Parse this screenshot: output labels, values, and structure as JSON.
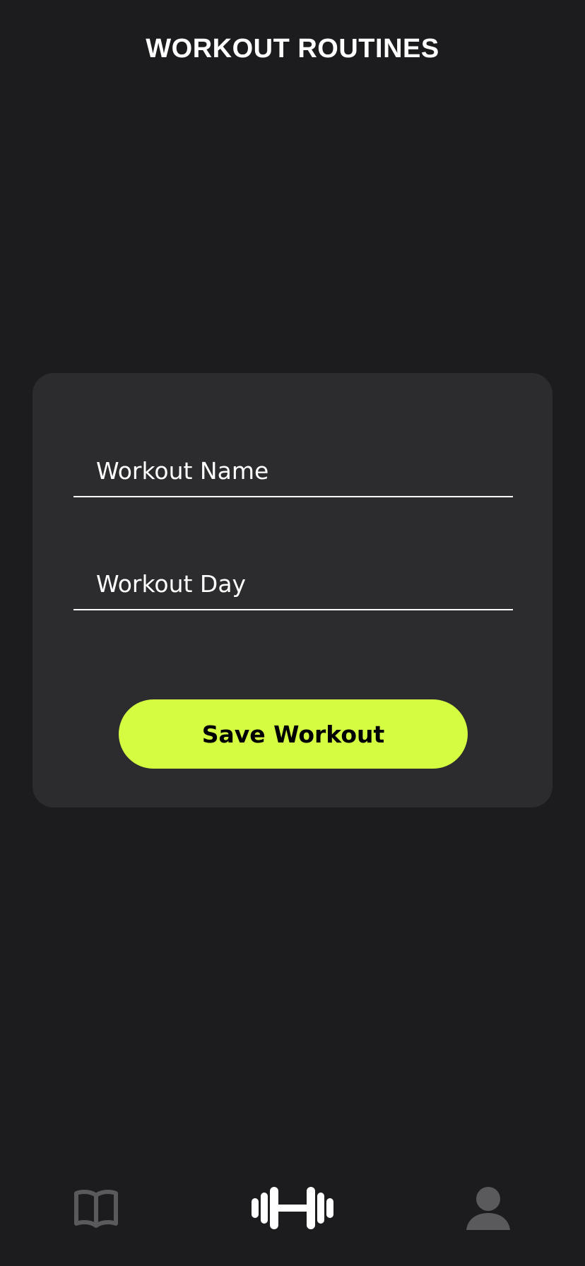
{
  "header": {
    "title": "WORKOUT ROUTINES"
  },
  "form": {
    "workout_name_placeholder": "Workout Name",
    "workout_day_placeholder": "Workout Day",
    "save_label": "Save Workout"
  },
  "bottom_nav": {
    "items": [
      {
        "icon": "book-icon",
        "active": false
      },
      {
        "icon": "dumbbell-icon",
        "active": true
      },
      {
        "icon": "user-icon",
        "active": false
      }
    ]
  },
  "colors": {
    "background": "#1c1c1e",
    "card": "#2c2c2e",
    "accent": "#d4fc41",
    "inactive_icon": "#5a5a5c",
    "active_icon": "#ffffff"
  }
}
